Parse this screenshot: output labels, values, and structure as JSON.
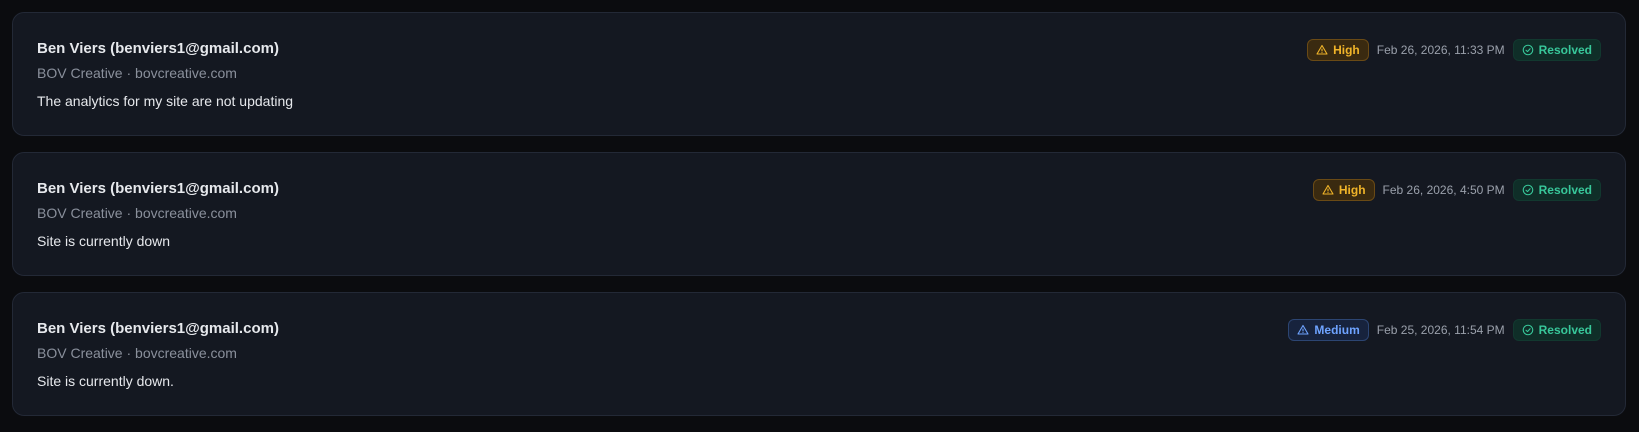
{
  "tickets": [
    {
      "name": "Ben Viers (benviers1@gmail.com)",
      "company": "BOV Creative · bovcreative.com",
      "message": "The analytics for my site are not updating",
      "priority": "High",
      "priority_color": "#f0b429",
      "date": "Feb 26, 2026, 11:33 PM",
      "status": "Resolved",
      "status_color": "#38c79a"
    },
    {
      "name": "Ben Viers (benviers1@gmail.com)",
      "company": "BOV Creative · bovcreative.com",
      "message": "Site is currently down",
      "priority": "High",
      "priority_color": "#f0b429",
      "date": "Feb 26, 2026, 4:50 PM",
      "status": "Resolved",
      "status_color": "#38c79a"
    },
    {
      "name": "Ben Viers (benviers1@gmail.com)",
      "company": "BOV Creative · bovcreative.com",
      "message": "Site is currently down.",
      "priority": "Medium",
      "priority_color": "#6ea3ff",
      "date": "Feb 25, 2026, 11:54 PM",
      "status": "Resolved",
      "status_color": "#38c79a"
    }
  ],
  "icons": {
    "priority": "warning-triangle-icon",
    "status": "check-circle-icon"
  }
}
